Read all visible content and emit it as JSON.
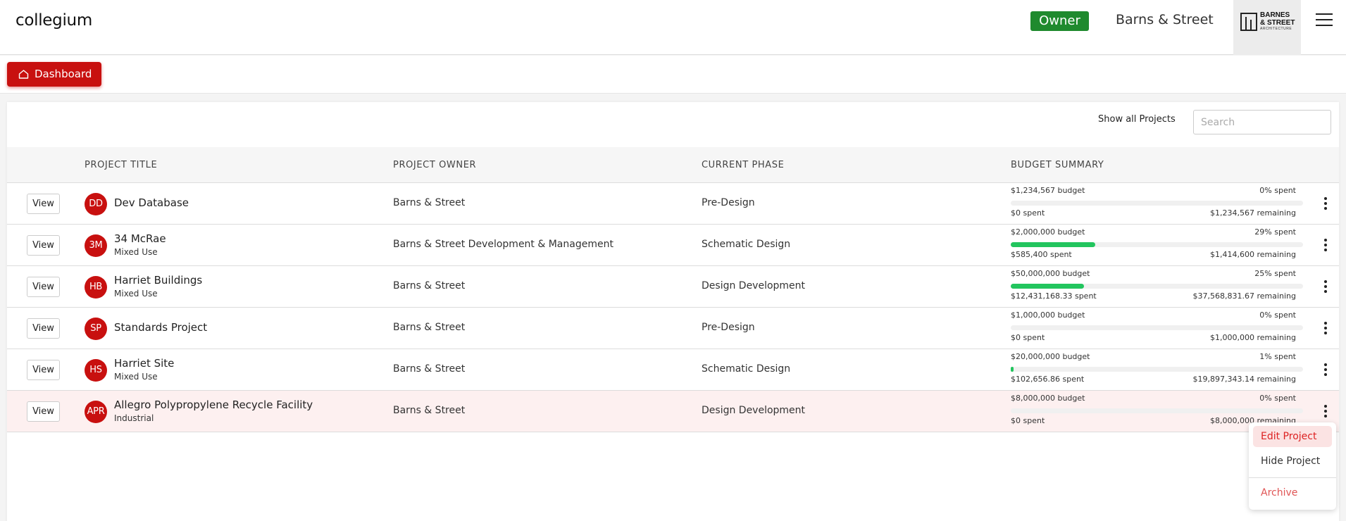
{
  "app": {
    "brand": "collegium"
  },
  "header": {
    "role_badge": "Owner",
    "org_name": "Barns & Street",
    "logo_text": "BARNES & STREET",
    "logo_subtext": "ARCHITECTURE"
  },
  "nav": {
    "dashboard_label": "Dashboard"
  },
  "toolbar": {
    "show_all_label": "Show all Projects",
    "search_placeholder": "Search"
  },
  "table": {
    "columns": [
      "PROJECT TITLE",
      "PROJECT OWNER",
      "CURRENT PHASE",
      "BUDGET SUMMARY"
    ],
    "view_label": "View",
    "rows": [
      {
        "initials": "DD",
        "title": "Dev Database",
        "subtitle": "",
        "owner": "Barns & Street",
        "phase": "Pre-Design",
        "budget": "$1,234,567 budget",
        "pct_label": "0% spent",
        "pct": 0,
        "spent": "$0 spent",
        "remaining": "$1,234,567 remaining"
      },
      {
        "initials": "3M",
        "title": "34 McRae",
        "subtitle": "Mixed Use",
        "owner": "Barns & Street Development & Management",
        "phase": "Schematic Design",
        "budget": "$2,000,000 budget",
        "pct_label": "29% spent",
        "pct": 29,
        "spent": "$585,400 spent",
        "remaining": "$1,414,600 remaining"
      },
      {
        "initials": "HB",
        "title": "Harriet Buildings",
        "subtitle": "Mixed Use",
        "owner": "Barns & Street",
        "phase": "Design Development",
        "budget": "$50,000,000 budget",
        "pct_label": "25% spent",
        "pct": 25,
        "spent": "$12,431,168.33 spent",
        "remaining": "$37,568,831.67 remaining"
      },
      {
        "initials": "SP",
        "title": "Standards Project",
        "subtitle": "",
        "owner": "Barns & Street",
        "phase": "Pre-Design",
        "budget": "$1,000,000 budget",
        "pct_label": "0% spent",
        "pct": 0,
        "spent": "$0 spent",
        "remaining": "$1,000,000 remaining"
      },
      {
        "initials": "HS",
        "title": "Harriet Site",
        "subtitle": "Mixed Use",
        "owner": "Barns & Street",
        "phase": "Schematic Design",
        "budget": "$20,000,000 budget",
        "pct_label": "1% spent",
        "pct": 1,
        "spent": "$102,656.86 spent",
        "remaining": "$19,897,343.14 remaining"
      },
      {
        "initials": "APR",
        "title": "Allegro Polypropylene Recycle Facility",
        "subtitle": "Industrial",
        "owner": "Barns & Street",
        "phase": "Design Development",
        "budget": "$8,000,000 budget",
        "pct_label": "0% spent",
        "pct": 0,
        "spent": "$0 spent",
        "remaining": "$8,000,000 remaining",
        "highlighted": true
      }
    ]
  },
  "context_menu": {
    "edit": "Edit Project",
    "hide": "Hide Project",
    "archive": "Archive"
  },
  "colors": {
    "primary_red": "#c8100f",
    "owner_green": "#1f8a2e",
    "progress_green": "#22c55e"
  }
}
